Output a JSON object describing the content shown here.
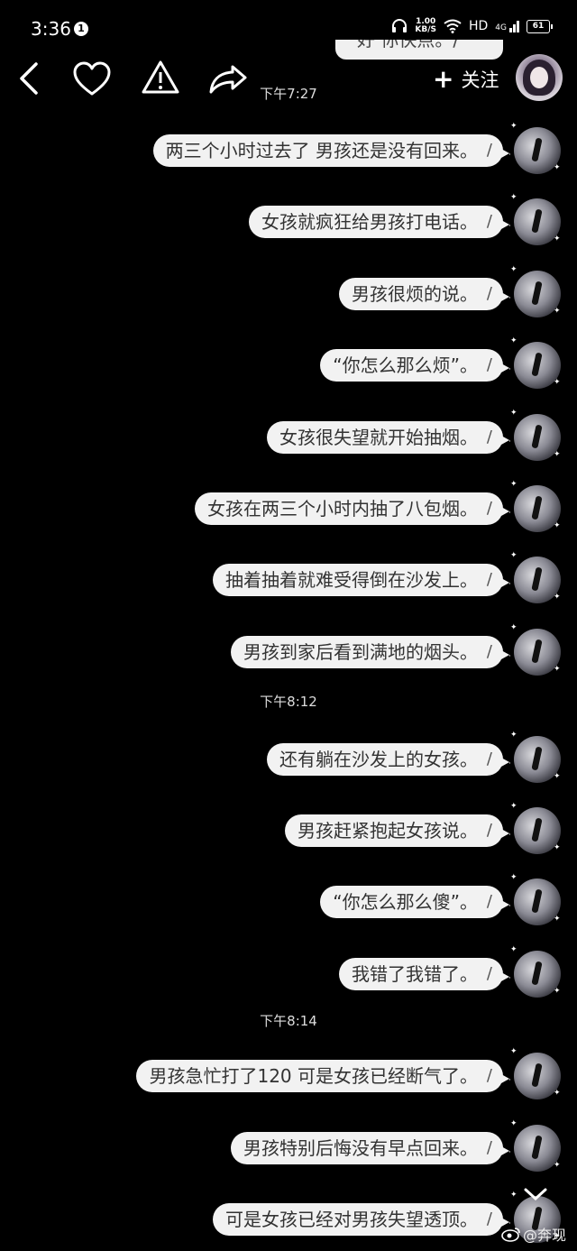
{
  "status_bar": {
    "time": "3:36",
    "notification_count": "1",
    "net_speed_value": "1.00",
    "net_speed_unit": "KB/S",
    "network": "HD",
    "signal": "4G",
    "battery": "61"
  },
  "header": {
    "follow_label": "关注",
    "follow_plus": "+",
    "first_time": "下午7:27"
  },
  "partial_top_message": "好  你快点。/",
  "messages_a": [
    "两三个小时过去了   男孩还是没有回来。",
    "女孩就疯狂给男孩打电话。",
    "男孩很烦的说。",
    "“你怎么那么烦”。",
    "女孩很失望就开始抽烟。",
    "女孩在两三个小时内抽了八包烟。",
    "抽着抽着就难受得倒在沙发上。",
    "男孩到家后看到满地的烟头。"
  ],
  "time_b": "下午8:12",
  "messages_b": [
    "还有躺在沙发上的女孩。",
    "男孩赶紧抱起女孩说。",
    "“你怎么那么傻”。",
    "我错了我错了。"
  ],
  "time_c": "下午8:14",
  "messages_c": [
    "男孩急忙打了120   可是女孩已经断气了。",
    "男孩特别后悔没有早点回来。",
    "可是女孩已经对男孩失望透顶。"
  ],
  "slash": "/",
  "watermark": "@奔现"
}
